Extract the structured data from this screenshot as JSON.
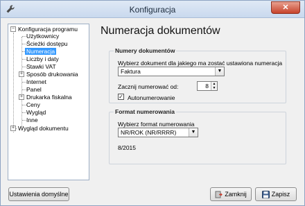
{
  "window": {
    "title": "Konfiguracja",
    "close_glyph": "✕"
  },
  "tree": {
    "items": [
      {
        "label": "Konfiguracja programu",
        "expander": "−"
      },
      {
        "label": "Użytkownicy"
      },
      {
        "label": "Ścieżki dostępu"
      },
      {
        "label": "Numeracja"
      },
      {
        "label": "Liczby i daty"
      },
      {
        "label": "Stawki VAT"
      },
      {
        "label": "Sposób drukowania",
        "expander": "+"
      },
      {
        "label": "Internet"
      },
      {
        "label": "Panel"
      },
      {
        "label": "Drukarka fiskalna",
        "expander": "+"
      },
      {
        "label": "Ceny"
      },
      {
        "label": "Wygląd"
      },
      {
        "label": "Inne"
      },
      {
        "label": "Wygląd dokumentu",
        "expander": "+"
      }
    ]
  },
  "main": {
    "page_title": "Numeracja dokumentów",
    "group_docs": {
      "title": "Numery dokumentów",
      "select_label": "Wybierz dokument dla jakiego ma zostać ustawiona numeracja",
      "doc_value": "Faktura",
      "start_label": "Zacznij numerować od:",
      "start_value": "8",
      "auto_label": "Autonumerowanie",
      "auto_checked": "✓"
    },
    "group_format": {
      "title": "Format numerowania",
      "select_label": "Wybierz format numerowania",
      "format_value": "NR/ROK (NR/RRRR)",
      "preview": "8/2015"
    }
  },
  "footer": {
    "defaults_label": "Ustawienia domyślne",
    "close_label": "Zamknij",
    "save_label": "Zapisz"
  },
  "colors": {
    "selection": "#3399ff",
    "titlebar": "#c9d9ee",
    "close": "#c7432b"
  }
}
